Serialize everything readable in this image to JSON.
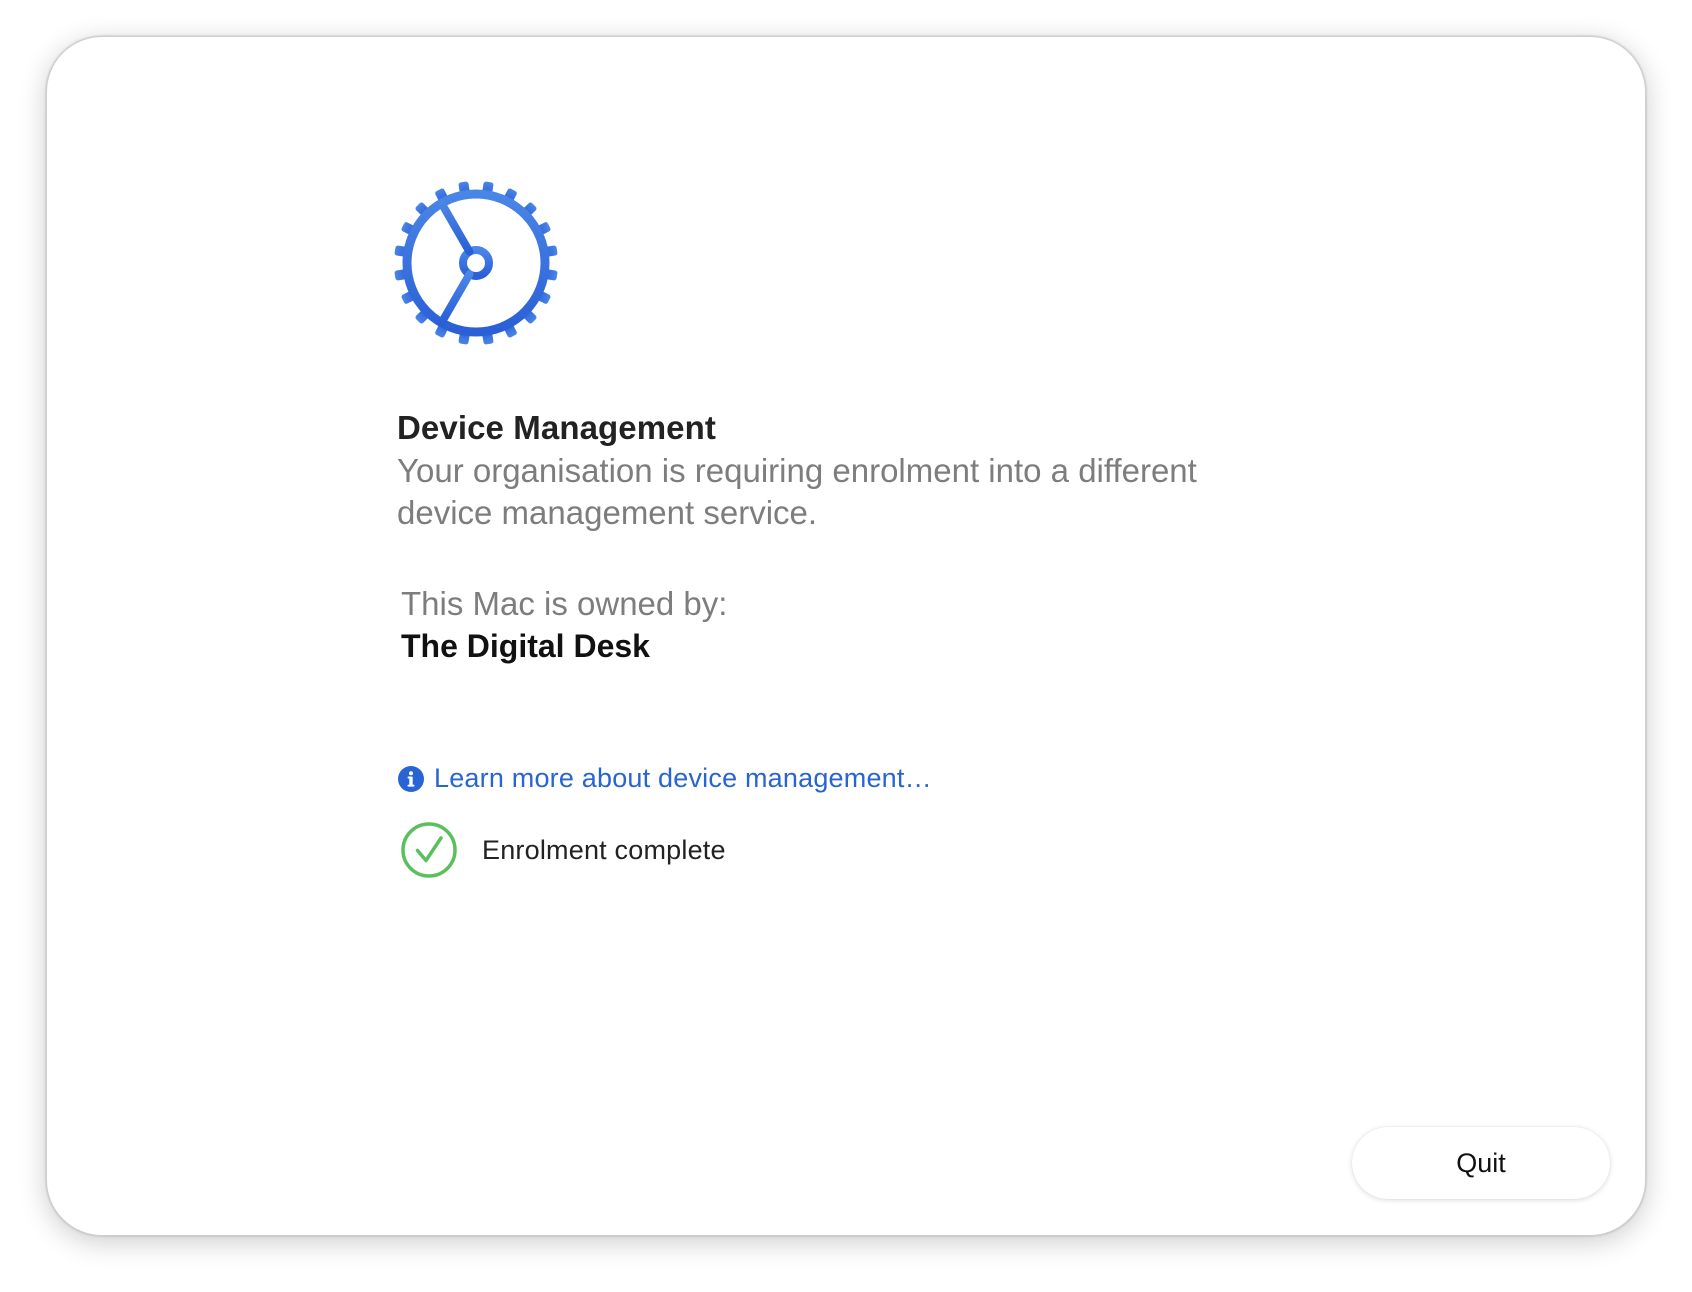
{
  "dialog": {
    "title": "Device Management",
    "subtitle": "Your organisation is requiring enrolment into a different device management service.",
    "owned_by_label": "This Mac is owned by:",
    "owner_name": "The Digital Desk",
    "learn_more_link": "Learn more about device management…",
    "status_text": "Enrolment complete",
    "quit_label": "Quit"
  },
  "icons": {
    "header": "gear-icon",
    "link": "info-icon",
    "status": "checkmark-circle-icon"
  },
  "colors": {
    "accent_blue": "#2864d2",
    "gear_blue": "#3a73dc",
    "success_green": "#5ac05e",
    "secondary_text": "#7d7d7d"
  }
}
